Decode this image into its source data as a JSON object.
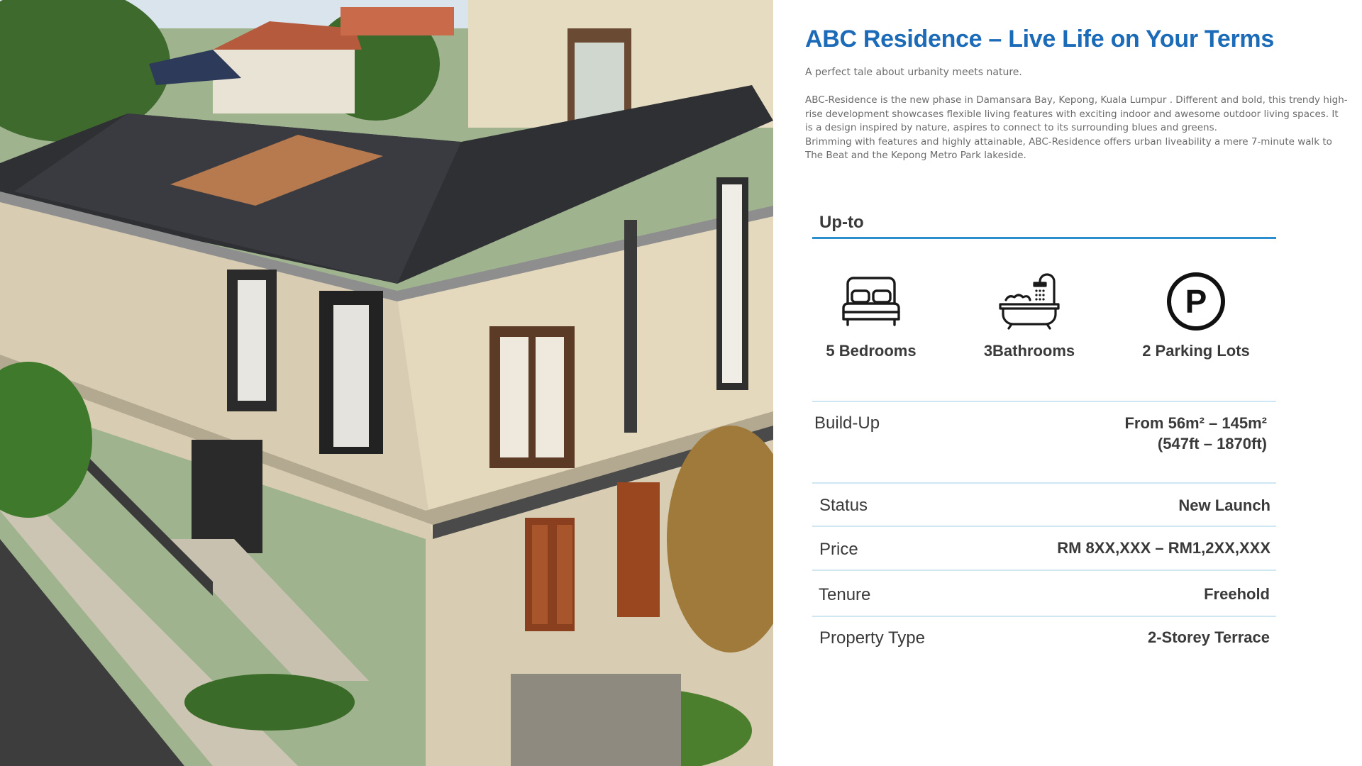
{
  "photo": {
    "alt_subject": "house-photo"
  },
  "header": {
    "title": "ABC Residence – Live Life on Your Terms",
    "subtitle": "A perfect tale about urbanity meets nature."
  },
  "description": {
    "para1": "ABC-Residence is the new phase in Damansara Bay, Kepong, Kuala Lumpur . Different and bold, this trendy high-rise development showcases flexible living features with exciting indoor and awesome outdoor living spaces. It is a design inspired by nature, aspires to connect to its surrounding blues and greens.",
    "para2": "Brimming with features and highly attainable, ABC-Residence offers urban liveability a mere 7-minute walk to The Beat and the Kepong Metro Park lakeside."
  },
  "upto": {
    "heading": "Up-to"
  },
  "features": [
    {
      "icon": "bed-icon",
      "label": "5 Bedrooms"
    },
    {
      "icon": "bathtub-icon",
      "label": "3Bathrooms"
    },
    {
      "icon": "parking-icon",
      "label": "2 Parking Lots"
    }
  ],
  "specs": {
    "buildup": {
      "label": "Build-Up",
      "value_line1": "From 56m² – 145m²",
      "value_line2": "(547ft – 1870ft)"
    },
    "status": {
      "label": "Status",
      "value": "New Launch"
    },
    "price": {
      "label": "Price",
      "value": "RM 8XX,XXX – RM1,2XX,XXX"
    },
    "tenure": {
      "label": "Tenure",
      "value": "Freehold"
    },
    "property_type": {
      "label": "Property Type",
      "value": "2-Storey Terrace"
    }
  },
  "colors": {
    "title_blue": "#1c6bb8",
    "rule_blue": "#2b8fcf",
    "rule_light": "#cfe7f3",
    "text_dark": "#3a3a3a",
    "text_grey": "#6b6b6b"
  }
}
